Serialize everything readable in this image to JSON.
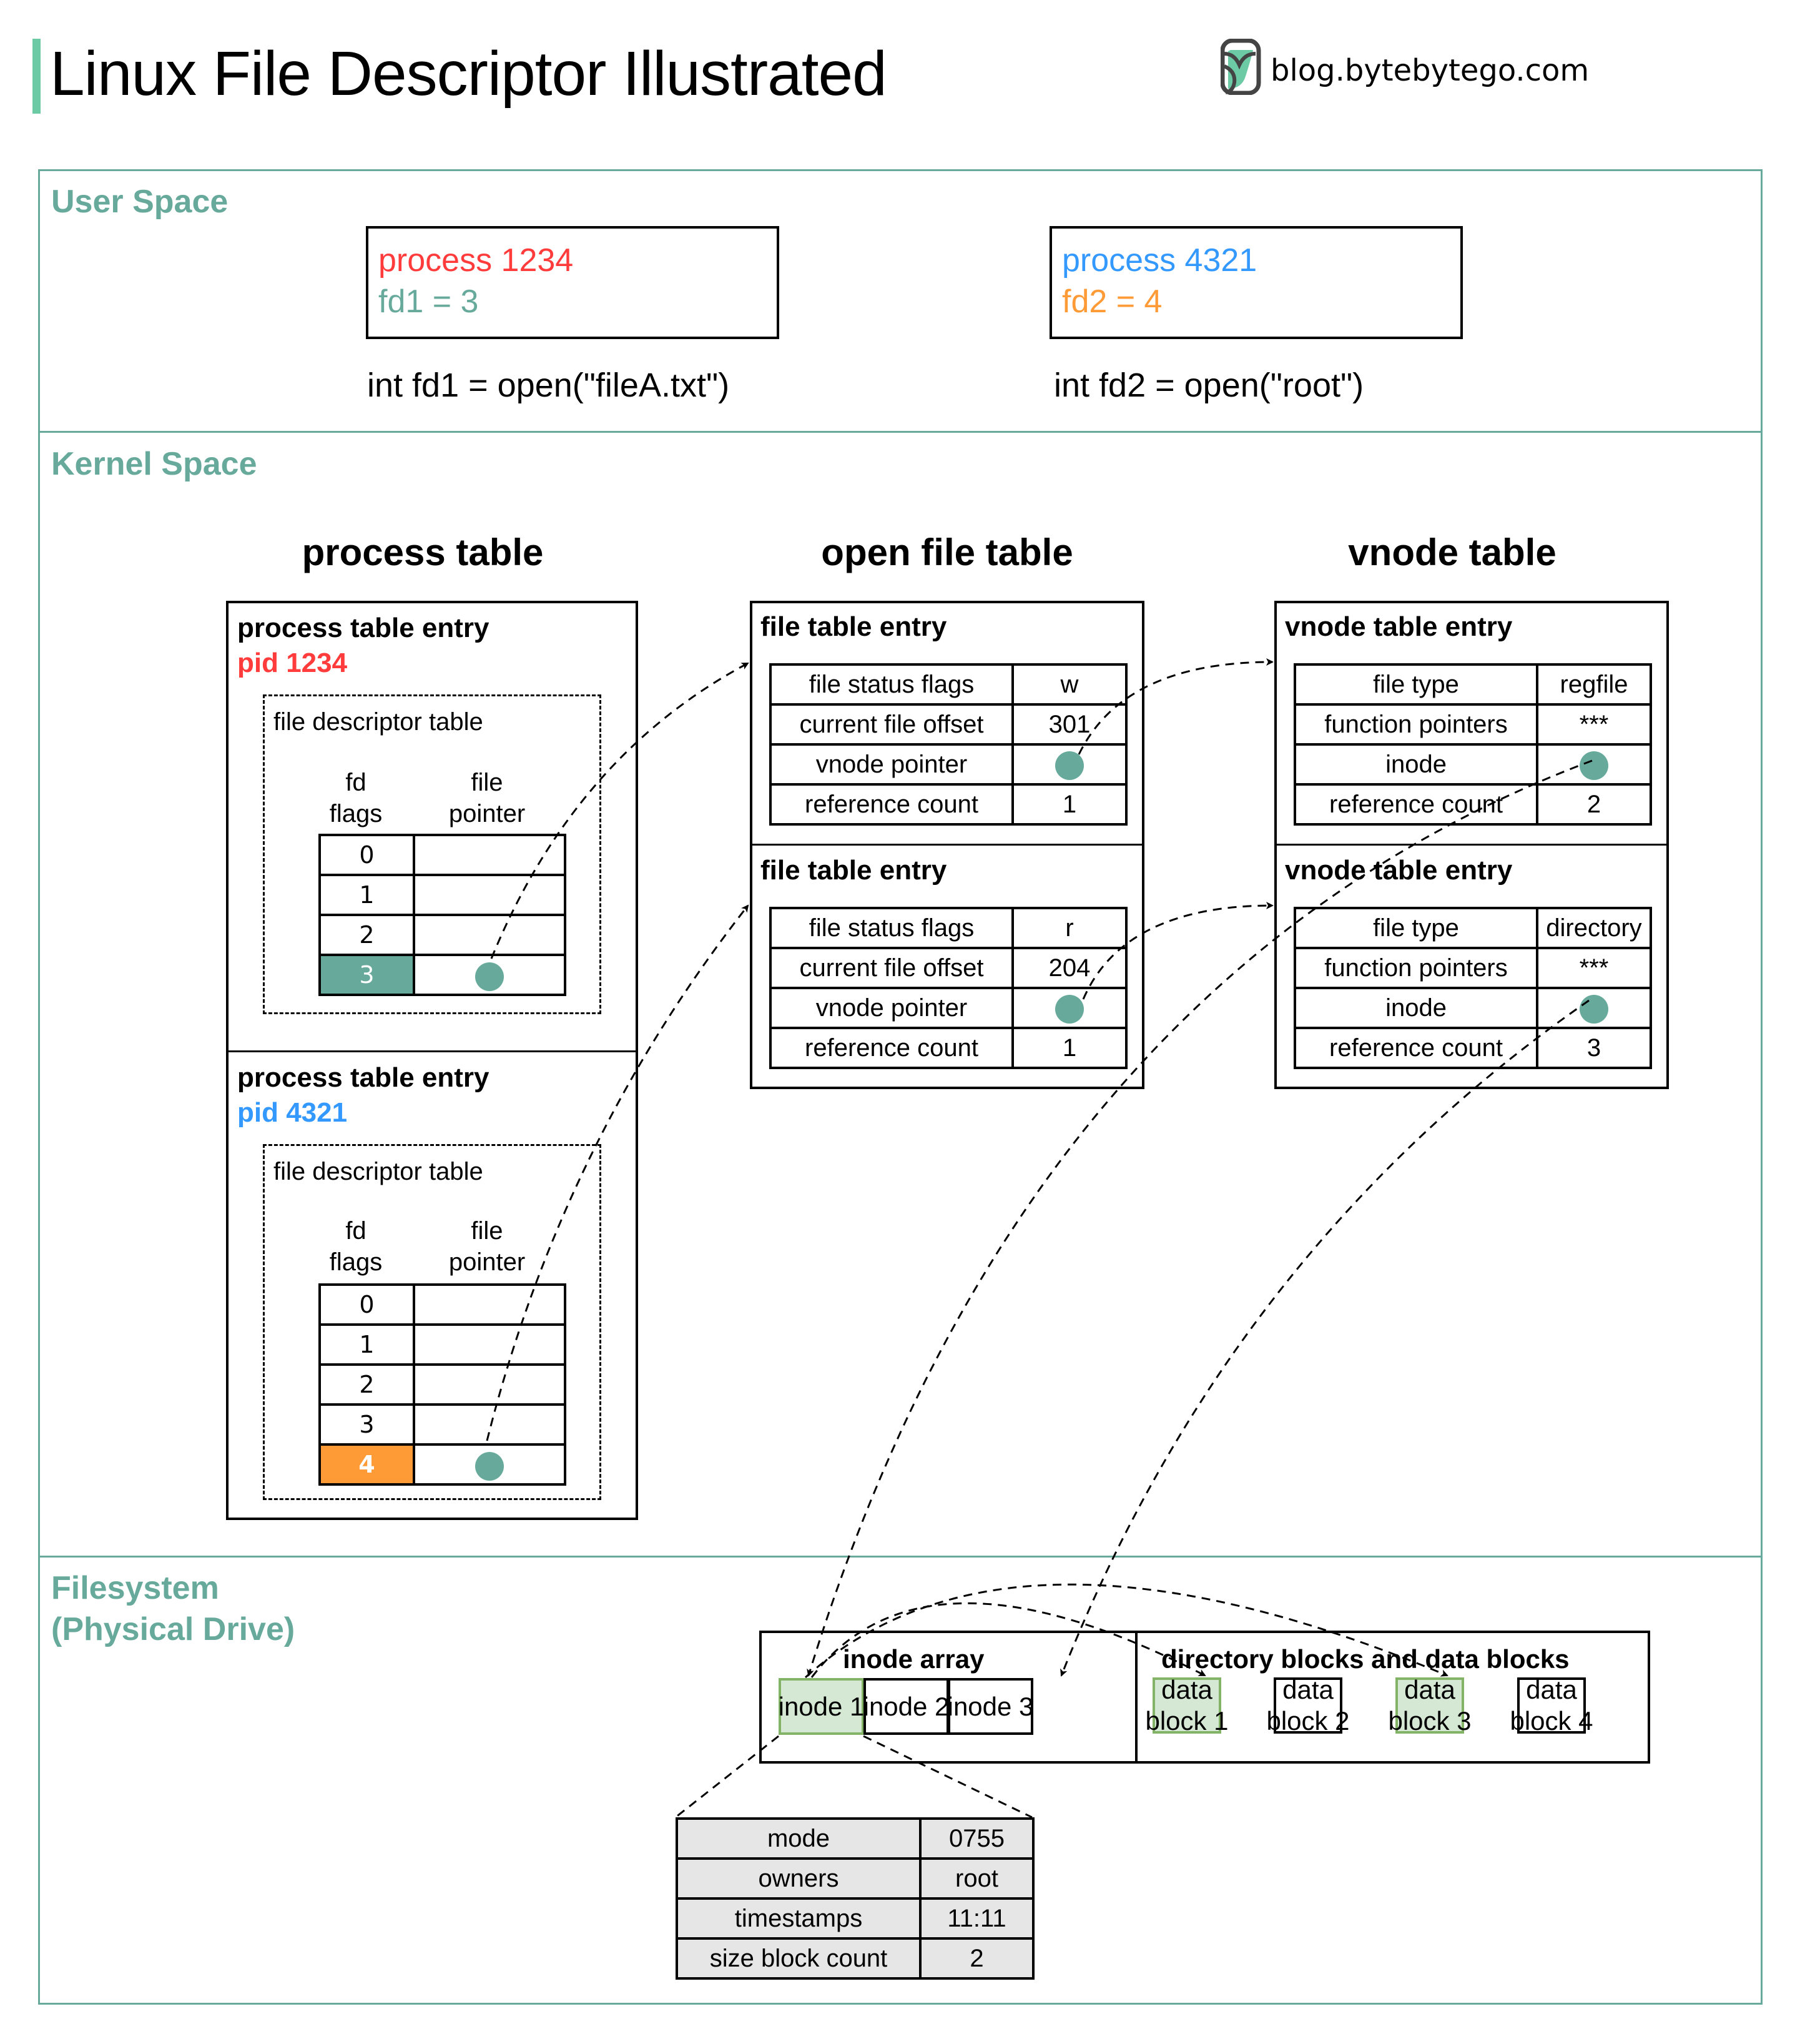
{
  "header": {
    "title": "Linux File Descriptor Illustrated",
    "brand": "blog.bytebytego.com",
    "brand_icon": "bytebytego-logo-icon"
  },
  "colors": {
    "section": "#67aa9c",
    "red": "#ff3b3b",
    "blue": "#3399ff",
    "orange": "#ff9b37",
    "teal": "#67aa9c",
    "green_fill": "#d5e8d4",
    "green_border": "#82b366",
    "gray_fill": "#e6e6e6"
  },
  "user_space": {
    "label": "User Space",
    "processes": [
      {
        "name": "process 1234",
        "fd": "fd1 = 3",
        "call": "int fd1 = open(\"fileA.txt\")"
      },
      {
        "name": "process 4321",
        "fd": "fd2 = 4",
        "call": "int fd2 = open(\"root\")"
      }
    ]
  },
  "kernel_space": {
    "label": "Kernel Space",
    "process_table": {
      "title": "process table",
      "entries": [
        {
          "title": "process table entry",
          "pid": "pid 1234",
          "fdt_label": "file descriptor table",
          "col_fd": [
            "fd",
            "flags"
          ],
          "col_ptr": [
            "file",
            "pointer"
          ],
          "rows": [
            "0",
            "1",
            "2",
            "3"
          ],
          "active_fd": "3"
        },
        {
          "title": "process table entry",
          "pid": "pid 4321",
          "fdt_label": "file descriptor table",
          "col_fd": [
            "fd",
            "flags"
          ],
          "col_ptr": [
            "file",
            "pointer"
          ],
          "rows": [
            "0",
            "1",
            "2",
            "3",
            "4"
          ],
          "active_fd": "4"
        }
      ]
    },
    "open_file_table": {
      "title": "open file table",
      "entries": [
        {
          "title": "file table entry",
          "rows": [
            {
              "k": "file status flags",
              "v": "w"
            },
            {
              "k": "current file offset",
              "v": "301"
            },
            {
              "k": "vnode pointer",
              "v": ""
            },
            {
              "k": "reference count",
              "v": "1"
            }
          ]
        },
        {
          "title": "file table entry",
          "rows": [
            {
              "k": "file status flags",
              "v": "r"
            },
            {
              "k": "current file offset",
              "v": "204"
            },
            {
              "k": "vnode pointer",
              "v": ""
            },
            {
              "k": "reference count",
              "v": "1"
            }
          ]
        }
      ]
    },
    "vnode_table": {
      "title": "vnode table",
      "entries": [
        {
          "title": "vnode table entry",
          "rows": [
            {
              "k": "file type",
              "v": "regfile"
            },
            {
              "k": "function pointers",
              "v": "***"
            },
            {
              "k": "inode",
              "v": ""
            },
            {
              "k": "reference count",
              "v": "2"
            }
          ]
        },
        {
          "title": "vnode table entry",
          "rows": [
            {
              "k": "file type",
              "v": "directory"
            },
            {
              "k": "function pointers",
              "v": "***"
            },
            {
              "k": "inode",
              "v": ""
            },
            {
              "k": "reference count",
              "v": "3"
            }
          ]
        }
      ]
    }
  },
  "filesystem": {
    "label_line1": "Filesystem",
    "label_line2": "(Physical Drive)",
    "inode_array": {
      "title": "inode array",
      "cells": [
        "inode 1",
        "inode 2",
        "inode 3"
      ]
    },
    "data_blocks": {
      "title": "directory blocks and data blocks",
      "cells": [
        {
          "l1": "data",
          "l2": "block 1"
        },
        {
          "l1": "data",
          "l2": "block 2"
        },
        {
          "l1": "data",
          "l2": "block 3"
        },
        {
          "l1": "data",
          "l2": "block 4"
        }
      ]
    },
    "inode_detail": [
      {
        "k": "mode",
        "v": "0755"
      },
      {
        "k": "owners",
        "v": "root"
      },
      {
        "k": "timestamps",
        "v": "11:11"
      },
      {
        "k": "size block count",
        "v": "2"
      }
    ]
  }
}
